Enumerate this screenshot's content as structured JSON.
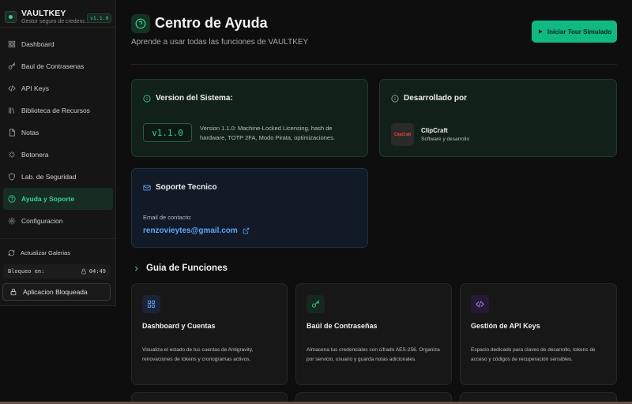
{
  "brand": {
    "name": "VAULTKEY",
    "subtitle": "Gestor seguro de credenc...",
    "version": "v1.1.0"
  },
  "sidebar": {
    "items": [
      {
        "label": "Dashboard",
        "icon": "grid-icon"
      },
      {
        "label": "Baul de Contrasenas",
        "icon": "key-icon"
      },
      {
        "label": "API Keys",
        "icon": "code-icon"
      },
      {
        "label": "Biblioteca de Recursos",
        "icon": "library-icon"
      },
      {
        "label": "Notas",
        "icon": "note-icon"
      },
      {
        "label": "Botonera",
        "icon": "sparkle-icon"
      },
      {
        "label": "Lab. de Seguridad",
        "icon": "shield-icon"
      },
      {
        "label": "Ayuda y Soporte",
        "icon": "help-icon",
        "active": true
      },
      {
        "label": "Configuracion",
        "icon": "gear-icon"
      }
    ],
    "refresh_label": "Actualizar Galerias",
    "lock_label": "Bloqueo en:",
    "lock_timer": "04:49",
    "lock_button": "Aplicacion Bloqueada"
  },
  "header": {
    "title": "Centro de Ayuda",
    "subtitle": "Aprende a usar todas las funciones de VAULTKEY",
    "tour_button": "Iniciar Tour Simulado"
  },
  "system": {
    "title": "Version del Sistema:",
    "version": "v1.1.0",
    "description": "Version 1.1.0: Machine-Locked Licensing, hash de hardware, TOTP 2FA, Modo Pirata, optimizaciones."
  },
  "developer": {
    "title": "Desarrollado por",
    "logo_text": "ClipCraft",
    "name": "ClipCraft",
    "role": "Software y desarrollo"
  },
  "support": {
    "title": "Soporte Tecnico",
    "email_label": "Email de contacto:",
    "email": "renzovieytes@gmail.com"
  },
  "guide": {
    "title": "Guia de Funciones",
    "features": [
      {
        "title": "Dashboard y Cuentas",
        "description": "Visualiza el estado de tus cuentas de Antigravity, renovaciones de tokens y cronogramas activos.",
        "icon": "grid-icon",
        "color": "#60a5fa"
      },
      {
        "title": "Baúl de Contraseñas",
        "description": "Almacena tus credenciales con cifrado AES-256. Organiza por servicio, usuario y guarda notas adicionales.",
        "icon": "key-icon",
        "color": "#34d399"
      },
      {
        "title": "Gestión de API Keys",
        "description": "Espacio dedicado para claves de desarrollo, tokens de acceso y códigos de recuperación sensibles.",
        "icon": "code-icon",
        "color": "#a78bfa"
      }
    ]
  },
  "colors": {
    "accent": "#10b981",
    "accent_text": "#34d399",
    "link": "#60a5fa",
    "background": "#0e0e0f"
  }
}
